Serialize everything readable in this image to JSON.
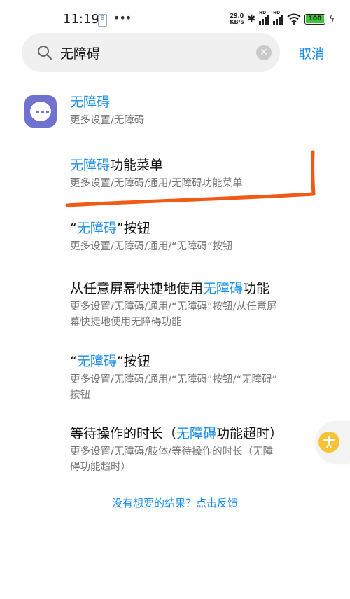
{
  "status_bar": {
    "time": "11:19",
    "notification_badge": "8",
    "overflow_dots": "•••",
    "net_speed_value": "29.0",
    "net_speed_unit": "KB/s",
    "signal_1_label": "HD",
    "signal_2_label": "HD",
    "battery_level": "100",
    "battery_color": "#3fc43a"
  },
  "search": {
    "query": "无障碍",
    "cancel_label": "取消"
  },
  "results": [
    {
      "title_parts": [
        "无障碍",
        "",
        ""
      ],
      "path": "更多设置/无障碍",
      "icon": "more-dots-app-icon"
    },
    {
      "title_parts": [
        "",
        "无障碍",
        "功能菜单"
      ],
      "path": "更多设置/无障碍/通用/无障碍功能菜单"
    },
    {
      "title_parts": [
        "“",
        "无障碍",
        "”按钮"
      ],
      "path": "更多设置/无障碍/通用/“无障碍”按钮"
    },
    {
      "title_parts": [
        "从任意屏幕快捷地使用",
        "无障碍",
        "功能"
      ],
      "path_line1": "更多设置/无障碍/通用/“无障碍”按钮/从任意屏",
      "path_line2": "幕快捷地使用无障碍功能"
    },
    {
      "title_parts": [
        "“",
        "无障碍",
        "”按钮"
      ],
      "path_line1": "更多设置/无障碍/通用/“无障碍”按钮/“无障碍”",
      "path_line2": "按钮"
    },
    {
      "title_parts": [
        "等待操作的时长（",
        "无障碍",
        "功能超时）"
      ],
      "path_line1": "更多设置/无障碍/肢体/等待操作的时长（无障",
      "path_line2": "碍功能超时）"
    }
  ],
  "feedback_link": "没有想要的结果？点击反馈",
  "colors": {
    "accent": "#1a8ee8",
    "highlight_scribble": "#f05a14",
    "app_icon_bg": "#6f72cf",
    "floating_button": "#f7c236"
  }
}
